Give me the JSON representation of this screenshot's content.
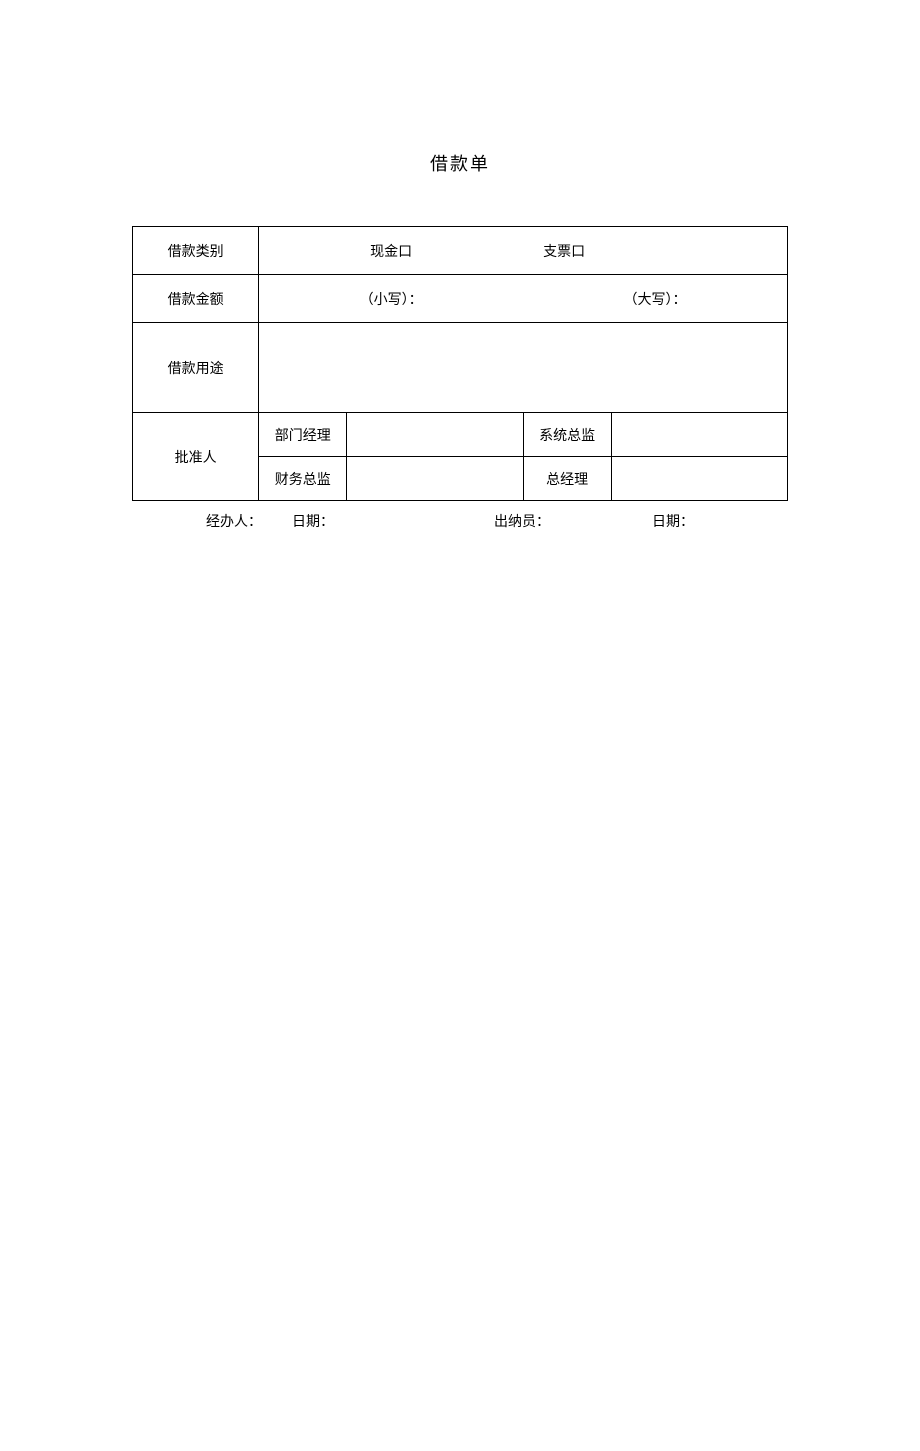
{
  "title": "借款单",
  "rows": {
    "type": {
      "label": "借款类别",
      "cash": "现金口",
      "check": "支票口"
    },
    "amount": {
      "label": "借款金额",
      "lower": "（小写）：",
      "upper": "（大写）："
    },
    "purpose": {
      "label": "借款用途"
    },
    "approver": {
      "label": "批准人",
      "dept_manager": "部门经理",
      "system_director": "系统总监",
      "finance_director": "财务总监",
      "general_manager": "总经理"
    }
  },
  "footer": {
    "handler": "经办人：",
    "date1": "日期：",
    "cashier": "出纳员：",
    "date2": "日期："
  }
}
